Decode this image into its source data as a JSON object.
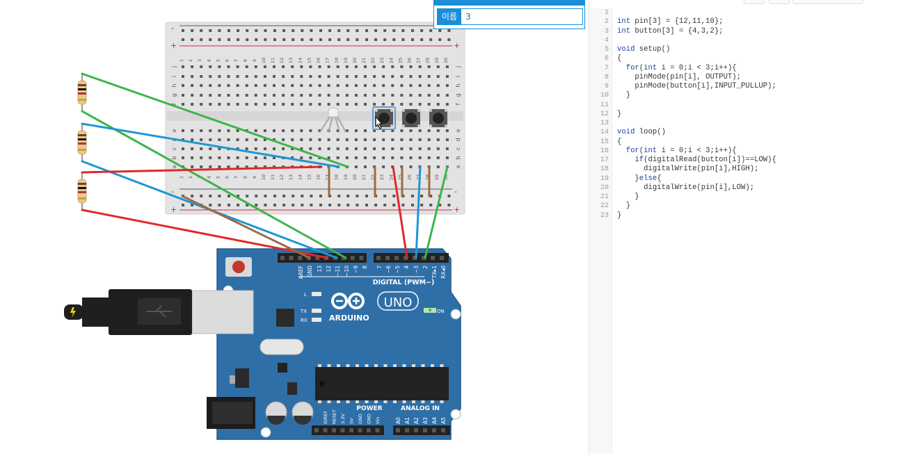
{
  "property_panel": {
    "label": "이름",
    "value": "3"
  },
  "breadboard": {
    "rows_top": [
      "j",
      "i",
      "h",
      "g",
      "f"
    ],
    "rows_bottom": [
      "e",
      "d",
      "c",
      "b",
      "a"
    ],
    "columns": [
      "1",
      "2",
      "3",
      "4",
      "5",
      "6",
      "7",
      "8",
      "9",
      "10",
      "11",
      "12",
      "13",
      "14",
      "15",
      "16",
      "17",
      "18",
      "19",
      "20",
      "21",
      "22",
      "23",
      "24",
      "25",
      "26",
      "27",
      "28",
      "29",
      "30"
    ],
    "rail_minus": "-",
    "rail_plus": "+"
  },
  "arduino": {
    "brand": "ARDUINO",
    "model": "UNO",
    "digital_header_label": "DIGITAL (PWM~)",
    "digital_pins": [
      "AREF",
      "GND",
      "13",
      "12",
      "~11",
      "~10",
      "~9",
      "8",
      "7",
      "~6",
      "~5",
      "4",
      "~3",
      "2",
      "TX▸1",
      "RX◂0"
    ],
    "power_header_label": "POWER",
    "analog_header_label": "ANALOG IN",
    "power_pins": [
      "IOREF",
      "RESET",
      "3.3V",
      "5V",
      "GND",
      "GND",
      "Vin"
    ],
    "analog_pins": [
      "A0",
      "A1",
      "A2",
      "A3",
      "A4",
      "A5"
    ],
    "led_labels": {
      "l": "L",
      "tx": "TX",
      "rx": "RX",
      "on": "ON"
    }
  },
  "code_editor": {
    "lines": [
      "",
      "int pin[3] = {12,11,10};",
      "int button[3] = {4,3,2};",
      "",
      "void setup()",
      "{",
      "  for(int i = 0;i < 3;i++){",
      "    pinMode(pin[i], OUTPUT);",
      "    pinMode(button[i],INPUT_PULLUP);",
      "  }",
      "",
      "}",
      "",
      "void loop()",
      "{",
      "  for(int i = 0;i < 3;i++){",
      "    if(digitalRead(button[i])==LOW){",
      "      digitalWrite(pin[i],HIGH);",
      "    }else{",
      "      digitalWrite(pin[i],LOW);",
      "    }",
      "  }",
      "}"
    ]
  },
  "colors": {
    "wire_red": "#e0282b",
    "wire_blue": "#1e96d2",
    "wire_green": "#3bb54a",
    "wire_brown": "#9b6b43",
    "arduino_blue": "#2f6fa8",
    "accent": "#1a8fd8"
  }
}
